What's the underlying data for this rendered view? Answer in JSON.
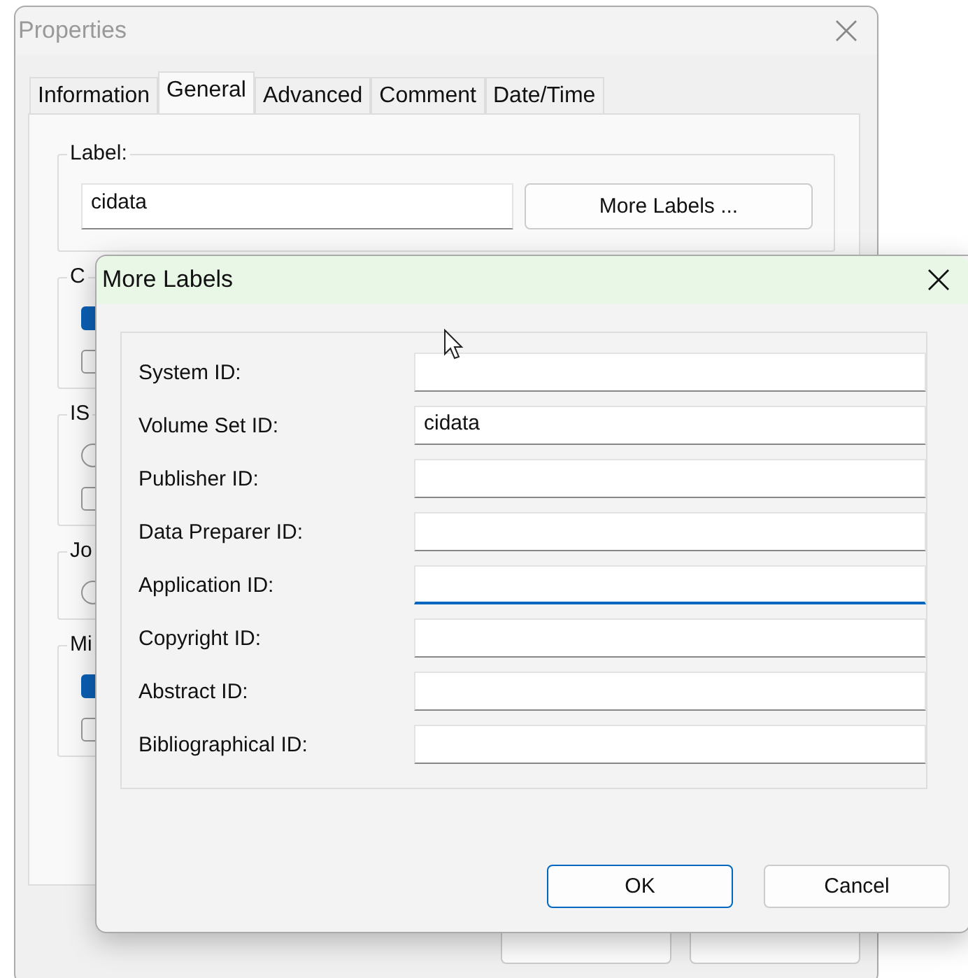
{
  "properties_window": {
    "title": "Properties",
    "tabs": [
      {
        "label": "Information",
        "selected": false
      },
      {
        "label": "General",
        "selected": true
      },
      {
        "label": "Advanced",
        "selected": false
      },
      {
        "label": "Comment",
        "selected": false
      },
      {
        "label": "Date/Time",
        "selected": false
      }
    ],
    "label_group": {
      "title": "Label:",
      "value": "cidata",
      "button": "More Labels ..."
    },
    "groups": [
      {
        "title": "C",
        "controls": [
          {
            "kind": "checkbox",
            "checked": true
          },
          {
            "kind": "checkbox",
            "checked": false
          }
        ]
      },
      {
        "title": "IS",
        "controls": [
          {
            "kind": "radio",
            "checked": false
          },
          {
            "kind": "checkbox",
            "checked": false
          }
        ]
      },
      {
        "title": "Jo",
        "controls": [
          {
            "kind": "radio",
            "checked": false
          }
        ]
      },
      {
        "title": "Mi",
        "controls": [
          {
            "kind": "checkbox",
            "checked": true
          },
          {
            "kind": "checkbox",
            "checked": false
          }
        ]
      }
    ]
  },
  "more_labels_dialog": {
    "title": "More Labels",
    "fields": [
      {
        "label": "System ID:",
        "focused": false
      },
      {
        "label": "Volume Set ID:",
        "value": "cidata",
        "focused": false
      },
      {
        "label": "Publisher ID:",
        "focused": false
      },
      {
        "label": "Data Preparer ID:",
        "focused": false
      },
      {
        "label": "Application ID:",
        "focused": true
      },
      {
        "label": "Copyright ID:",
        "focused": false
      },
      {
        "label": "Abstract ID:",
        "focused": false
      },
      {
        "label": "Bibliographical ID:",
        "focused": false
      }
    ],
    "buttons": [
      {
        "label": "OK",
        "default": true
      },
      {
        "label": "Cancel",
        "default": false
      }
    ]
  }
}
